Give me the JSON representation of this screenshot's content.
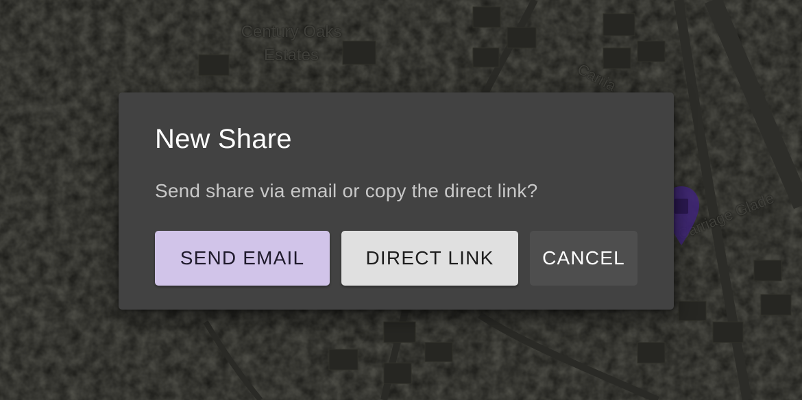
{
  "map": {
    "area_label_line1": "Century Oaks",
    "area_label_line2": "Estates",
    "street_label": "Carriage Glade",
    "street_label_partial": "Carria"
  },
  "dialog": {
    "title": "New Share",
    "message": "Send share via email or copy the direct link?",
    "buttons": {
      "send_email": "SEND EMAIL",
      "direct_link": "DIRECT LINK",
      "cancel": "CANCEL"
    }
  },
  "colors": {
    "dialog_bg": "#424242",
    "primary_button": "#d1c4e9",
    "secondary_button": "#e0e0e0",
    "cancel_button": "#4e4e4e",
    "pin": "#5b2fa8"
  },
  "icons": {
    "map_pin": "map-marker-icon"
  }
}
